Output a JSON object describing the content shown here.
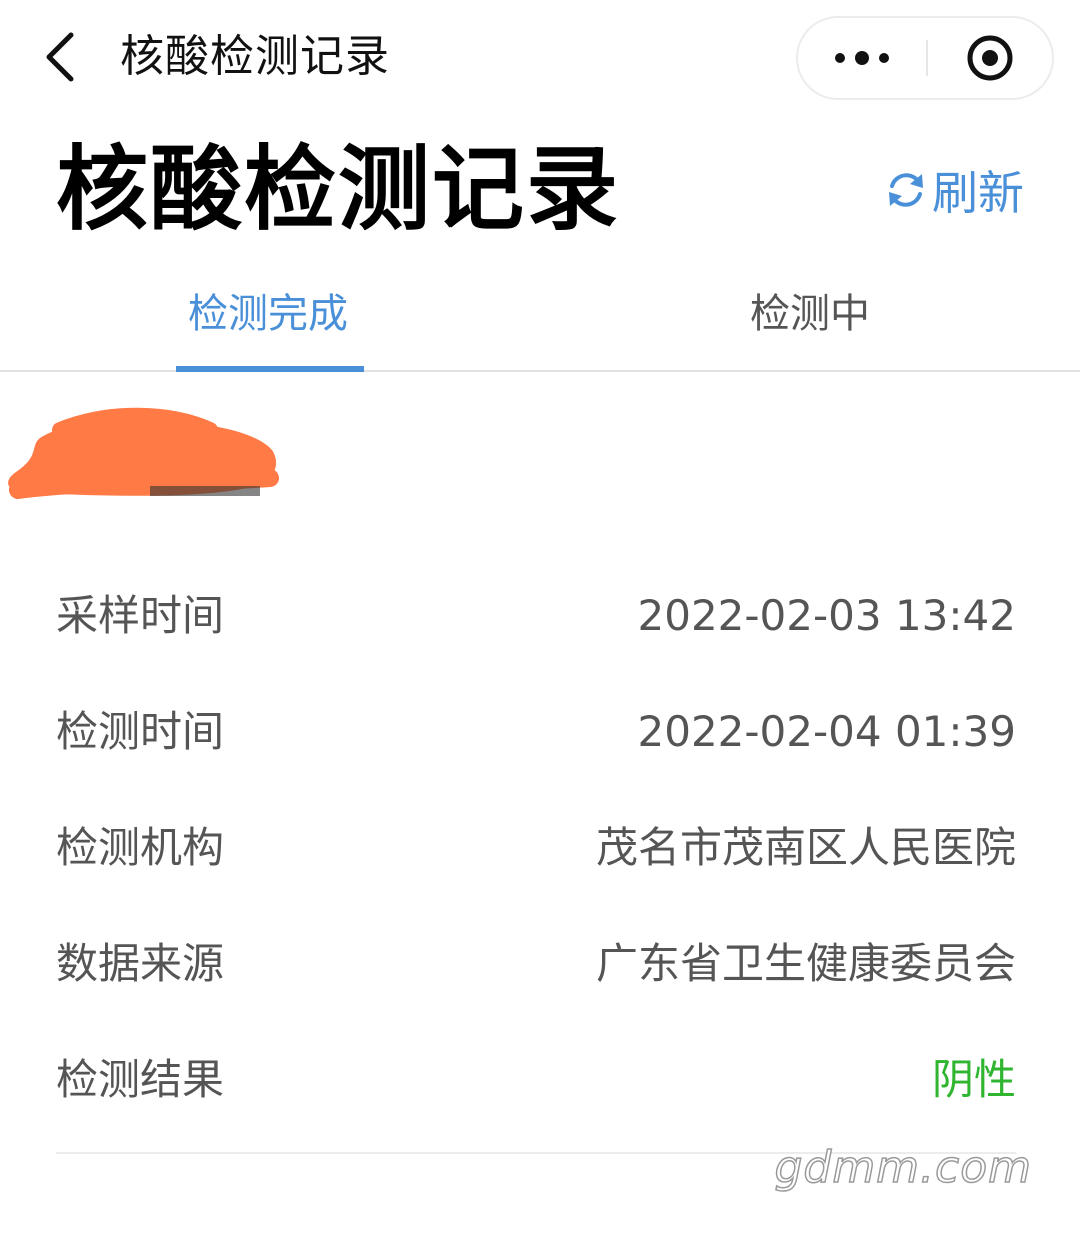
{
  "navbar": {
    "title": "核酸检测记录",
    "back_icon": "chevron-left-icon",
    "more_icon": "more-dots-icon",
    "close_icon": "target-circle-icon"
  },
  "header": {
    "title": "核酸检测记录",
    "refresh_label": "刷新",
    "refresh_icon": "refresh-icon"
  },
  "tabs": [
    {
      "label": "检测完成",
      "active": true
    },
    {
      "label": "检测中",
      "active": false
    }
  ],
  "record": {
    "rows": [
      {
        "label": "采样时间",
        "value": "2022-02-03 13:42"
      },
      {
        "label": "检测时间",
        "value": "2022-02-04 01:39"
      },
      {
        "label": "检测机构",
        "value": "茂名市茂南区人民医院"
      },
      {
        "label": "数据来源",
        "value": "广东省卫生健康委员会"
      },
      {
        "label": "检测结果",
        "value": "阴性"
      }
    ]
  },
  "watermark": "gdmm.com",
  "colors": {
    "accent": "#4a90d9",
    "negative": "#2fb52f",
    "redaction": "#ff7a45"
  }
}
